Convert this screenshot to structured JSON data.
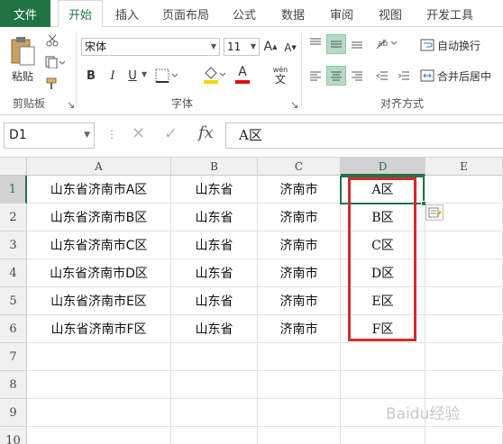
{
  "tabs": {
    "file": "文件",
    "home": "开始",
    "insert": "插入",
    "page_layout": "页面布局",
    "formulas": "公式",
    "data": "数据",
    "review": "审阅",
    "view": "视图",
    "developer": "开发工具"
  },
  "ribbon": {
    "clipboard": {
      "paste_label": "粘贴",
      "group_label": "剪贴板"
    },
    "font": {
      "font_name": "宋体",
      "font_size": "11",
      "grow": "A",
      "shrink": "A",
      "bold": "B",
      "italic": "I",
      "underline": "U",
      "font_color": "A",
      "phonetic_top": "wén",
      "phonetic_bottom": "文",
      "group_label": "字体"
    },
    "alignment": {
      "wrap_text": "自动换行",
      "merge_center": "合并后居中",
      "group_label": "对齐方式"
    }
  },
  "formula_bar": {
    "name_box": "D1",
    "cancel": "✕",
    "enter": "✓",
    "fx": "fx",
    "content": "A区"
  },
  "sheet": {
    "columns": [
      "A",
      "B",
      "C",
      "D",
      "E"
    ],
    "rows": [
      "1",
      "2",
      "3",
      "4",
      "5",
      "6",
      "7",
      "8",
      "9",
      "10"
    ],
    "selected_cell": "D1",
    "data": [
      [
        "山东省济南市A区",
        "山东省",
        "济南市",
        "A区"
      ],
      [
        "山东省济南市B区",
        "山东省",
        "济南市",
        "B区"
      ],
      [
        "山东省济南市C区",
        "山东省",
        "济南市",
        "C区"
      ],
      [
        "山东省济南市D区",
        "山东省",
        "济南市",
        "D区"
      ],
      [
        "山东省济南市E区",
        "山东省",
        "济南市",
        "E区"
      ],
      [
        "山东省济南市F区",
        "山东省",
        "济南市",
        "F区"
      ]
    ]
  },
  "watermark": "Baidu经验",
  "colors": {
    "excel_green": "#217346",
    "highlight_red": "#d32b2b",
    "selected_button": "#b3dbc5"
  }
}
